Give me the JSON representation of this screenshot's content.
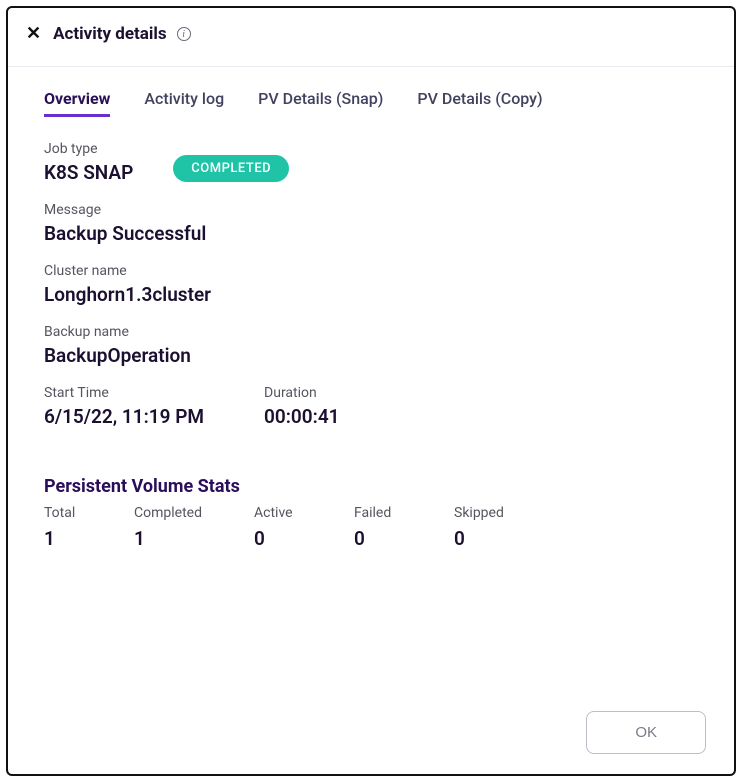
{
  "header": {
    "title": "Activity details"
  },
  "tabs": {
    "overview": "Overview",
    "activity_log": "Activity log",
    "pv_snap": "PV Details (Snap)",
    "pv_copy": "PV Details (Copy)"
  },
  "fields": {
    "job_type_label": "Job type",
    "job_type_value": "K8S SNAP",
    "status_badge": "COMPLETED",
    "message_label": "Message",
    "message_value": "Backup Successful",
    "cluster_label": "Cluster name",
    "cluster_value": "Longhorn1.3cluster",
    "backup_label": "Backup name",
    "backup_value": "BackupOperation",
    "start_time_label": "Start Time",
    "start_time_value": "6/15/22, 11:19 PM",
    "duration_label": "Duration",
    "duration_value": "00:00:41"
  },
  "pv_stats": {
    "title": "Persistent Volume Stats",
    "total_label": "Total",
    "total_value": "1",
    "completed_label": "Completed",
    "completed_value": "1",
    "active_label": "Active",
    "active_value": "0",
    "failed_label": "Failed",
    "failed_value": "0",
    "skipped_label": "Skipped",
    "skipped_value": "0"
  },
  "footer": {
    "ok": "OK"
  }
}
